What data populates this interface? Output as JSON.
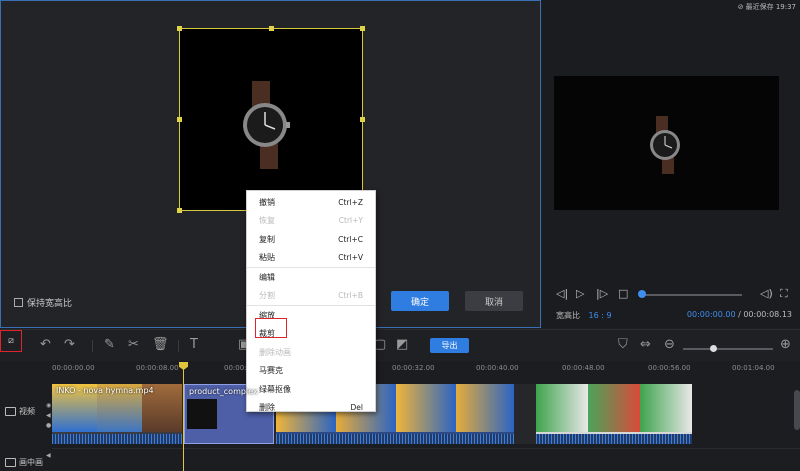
{
  "crop_panel": {
    "keep_ratio_label": "保持宽高比",
    "confirm_label": "确定",
    "cancel_label": "取消"
  },
  "preview": {
    "save_status": "最近保存 19:37",
    "ratio_label": "宽高比",
    "ratio_value": "16 : 9",
    "time_current": "00:00:00.00",
    "time_separator": "/",
    "time_total": "00:00:08.13"
  },
  "toolbar": {
    "export_label": "导出"
  },
  "timeline": {
    "ticks": [
      "00:00:00.00",
      "00:00:08.00",
      "00:00:16.00",
      "00:00:32.00",
      "00:00:40.00",
      "00:00:48.00",
      "00:00:56.00",
      "00:01:04.00"
    ],
    "video_track_label": "视频",
    "pip_track_label": "画中画",
    "clips": [
      {
        "title": "INKO - nova hymna.mp4"
      },
      {
        "title": "product_complex"
      }
    ]
  },
  "context_menu": {
    "items": [
      {
        "label": "撤销",
        "shortcut": "Ctrl+Z",
        "enabled": true
      },
      {
        "label": "恢复",
        "shortcut": "Ctrl+Y",
        "enabled": false
      },
      {
        "label": "复制",
        "shortcut": "Ctrl+C",
        "enabled": true
      },
      {
        "label": "粘贴",
        "shortcut": "Ctrl+V",
        "enabled": true
      },
      {
        "label": "编辑",
        "shortcut": "",
        "enabled": true
      },
      {
        "label": "分割",
        "shortcut": "Ctrl+B",
        "enabled": false
      },
      {
        "label": "缩放",
        "shortcut": "",
        "enabled": true
      },
      {
        "label": "裁剪",
        "shortcut": "",
        "enabled": true
      },
      {
        "label": "删除动画",
        "shortcut": "",
        "enabled": false
      },
      {
        "label": "马赛克",
        "shortcut": "",
        "enabled": true
      },
      {
        "label": "绿幕抠像",
        "shortcut": "",
        "enabled": true
      },
      {
        "label": "删除",
        "shortcut": "Del",
        "enabled": true
      }
    ]
  },
  "colors": {
    "accent": "#2f7de1",
    "highlight": "#e0242e",
    "crop_border": "#d8c93a",
    "playhead": "#e0c63a"
  }
}
